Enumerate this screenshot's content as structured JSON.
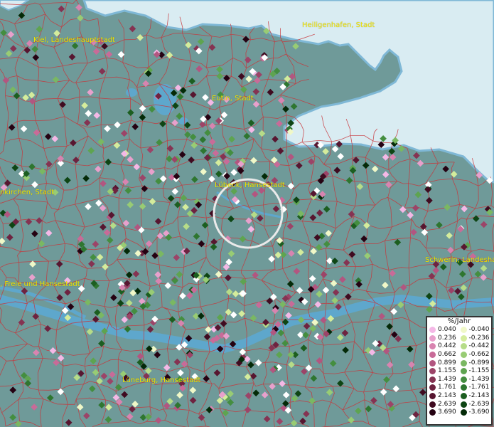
{
  "map": {
    "colors": {
      "land": "#6f9a99",
      "sea": "#d9ecf2",
      "sea_edge": "#7fb8d6",
      "river": "#5ea7cc",
      "boundary": "#c8353a",
      "label": "#f2e600"
    }
  },
  "places": [
    {
      "id": "kiel",
      "name": "Kiel, Landeshauptstadt"
    },
    {
      "id": "heiligenhafen",
      "name": "Heiligenhafen, Stadt"
    },
    {
      "id": "eutin",
      "name": "Eutin, Stadt"
    },
    {
      "id": "luebeck",
      "name": "Lübeck, Hansestadt"
    },
    {
      "id": "neumuenster",
      "name": "nkirchen, Stadt"
    },
    {
      "id": "hamburg",
      "name": ", Freie und Hansestadt"
    },
    {
      "id": "schwerin",
      "name": "Schwerin, Landeshau"
    },
    {
      "id": "lueneburg",
      "name": "Lüneburg, Hansestadt"
    }
  ],
  "legend": {
    "title": "%/Jahr",
    "positive": [
      {
        "label": "0.040",
        "color": "#f4b8e6"
      },
      {
        "label": "0.236",
        "color": "#e8a0cc"
      },
      {
        "label": "0.442",
        "color": "#d884b0"
      },
      {
        "label": "0.662",
        "color": "#c86b98"
      },
      {
        "label": "0.899",
        "color": "#b25680"
      },
      {
        "label": "1.155",
        "color": "#9c4468"
      },
      {
        "label": "1.439",
        "color": "#853352"
      },
      {
        "label": "1.761",
        "color": "#6e2340"
      },
      {
        "label": "2.143",
        "color": "#571630"
      },
      {
        "label": "2.639",
        "color": "#3f0b20"
      },
      {
        "label": "3.690",
        "color": "#250212"
      }
    ],
    "negative": [
      {
        "label": "-0.040",
        "color": "#f0f8c8"
      },
      {
        "label": "-0.236",
        "color": "#d4ec9c"
      },
      {
        "label": "-0.442",
        "color": "#b6dc88"
      },
      {
        "label": "-0.662",
        "color": "#98cc74"
      },
      {
        "label": "-0.899",
        "color": "#7ab862"
      },
      {
        "label": "-1.155",
        "color": "#5ea450"
      },
      {
        "label": "-1.439",
        "color": "#448e40"
      },
      {
        "label": "-1.761",
        "color": "#2e7630"
      },
      {
        "label": "-2.143",
        "color": "#1c5e20"
      },
      {
        "label": "-2.639",
        "color": "#0e4514"
      },
      {
        "label": "-3.690",
        "color": "#042a08"
      }
    ]
  }
}
